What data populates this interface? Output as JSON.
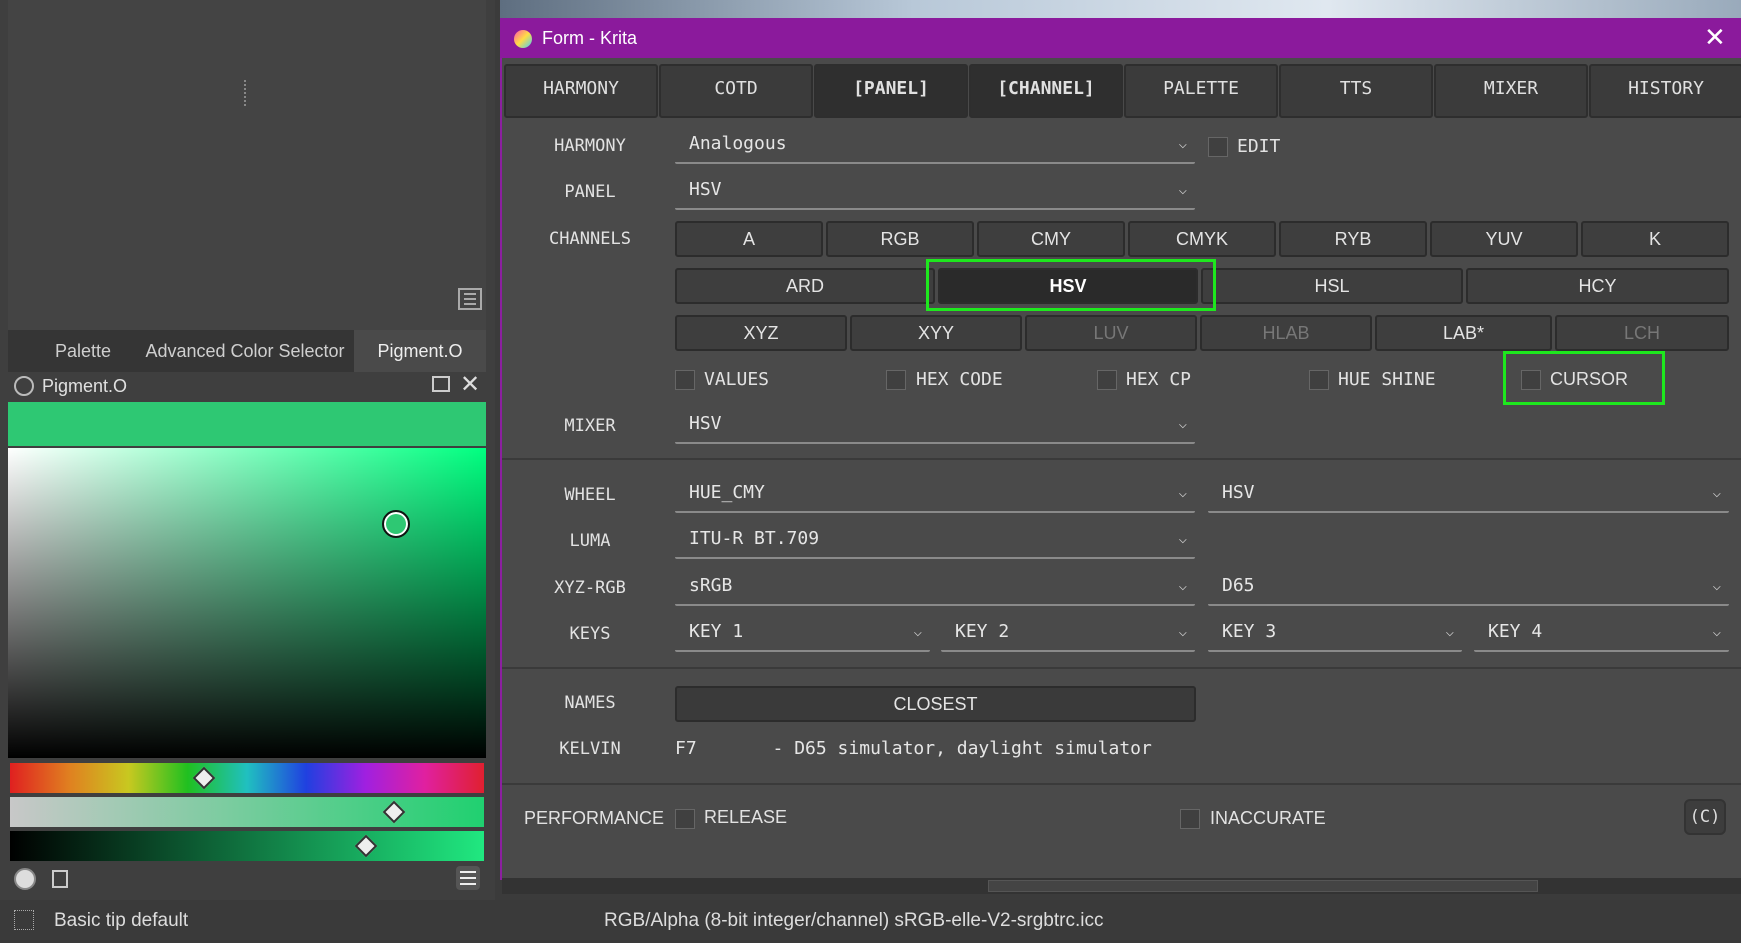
{
  "left_panel": {
    "tabs": [
      "Palette",
      "Advanced Color Selector",
      "Pigment.O"
    ],
    "docker_title": "Pigment.O",
    "color_preview": "#2ec873",
    "sv_hue_color": "#00ff80",
    "slider_hue_level": 0.41,
    "slider_sat_level": 0.81,
    "slider_val_level": 0.75,
    "status_brush": "Basic tip default"
  },
  "window": {
    "title": "Form - Krita",
    "tabs": [
      "HARMONY",
      "COTD",
      "[PANEL]",
      "[CHANNEL]",
      "PALETTE",
      "TTS",
      "MIXER",
      "HISTORY"
    ],
    "harmony_label": "HARMONY",
    "harmony_value": "Analogous",
    "edit_label": "EDIT",
    "panel_label": "PANEL",
    "panel_value": "HSV",
    "channels_label": "CHANNELS",
    "channels_row1": [
      "A",
      "RGB",
      "CMY",
      "CMYK",
      "RYB",
      "YUV",
      "K"
    ],
    "channels_row2": [
      "ARD",
      "HSV",
      "HSL",
      "HCY"
    ],
    "channels_row3": [
      "XYZ",
      "XYY",
      "LUV",
      "HLAB",
      "LAB*",
      "LCH"
    ],
    "checks": [
      "VALUES",
      "HEX CODE",
      "HEX CP",
      "HUE SHINE",
      "CURSOR"
    ],
    "mixer_label": "MIXER",
    "mixer_value": "HSV",
    "wheel_label": "WHEEL",
    "wheel_value": "HUE_CMY",
    "wheel_value2": "HSV",
    "luma_label": "LUMA",
    "luma_value": "ITU-R BT.709",
    "xyz_label": "XYZ-RGB",
    "xyz_value": "sRGB",
    "xyz_value2": "D65",
    "keys_label": "KEYS",
    "keys": [
      "KEY 1",
      "KEY 2",
      "KEY 3",
      "KEY 4"
    ],
    "names_label": "NAMES",
    "closest_label": "CLOSEST",
    "kelvin_label": "KELVIN",
    "kelvin_value": "F7       - D65 simulator, daylight simulator",
    "performance_label": "PERFORMANCE",
    "release_label": "RELEASE",
    "inaccurate_label": "INACCURATE",
    "copyright_label": "(C)"
  },
  "statusbar": {
    "color_profile": "RGB/Alpha (8-bit integer/channel)  sRGB-elle-V2-srgbtrc.icc"
  }
}
